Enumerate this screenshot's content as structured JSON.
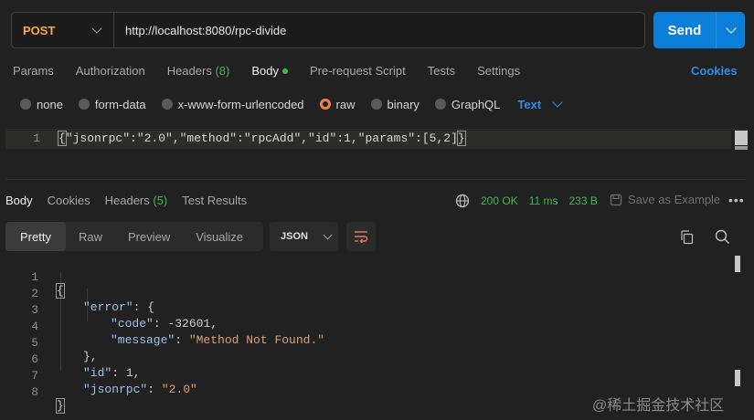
{
  "request": {
    "method": "POST",
    "url": "http://localhost:8080/rpc-divide",
    "send_label": "Send"
  },
  "request_tabs": [
    {
      "label": "Params"
    },
    {
      "label": "Authorization"
    },
    {
      "label": "Headers",
      "count": "(8)"
    },
    {
      "label": "Body"
    },
    {
      "label": "Pre-request Script"
    },
    {
      "label": "Tests"
    },
    {
      "label": "Settings"
    }
  ],
  "cookies_label": "Cookies",
  "body_types": [
    "none",
    "form-data",
    "x-www-form-urlencoded",
    "raw",
    "binary",
    "GraphQL"
  ],
  "body_format": "Text",
  "request_body": {
    "line_number": "1",
    "open_brace": "{",
    "content": "\"jsonrpc\":\"2.0\",\"method\":\"rpcAdd\",\"id\":1,\"params\":[5,2]",
    "close_brace": "}"
  },
  "response_tabs": [
    {
      "label": "Body"
    },
    {
      "label": "Cookies"
    },
    {
      "label": "Headers",
      "count": "(5)"
    },
    {
      "label": "Test Results"
    }
  ],
  "status": {
    "code": "200 OK",
    "time": "11 ms",
    "size": "233 B"
  },
  "save_example_label": "Save as Example",
  "view_modes": [
    "Pretty",
    "Raw",
    "Preview",
    "Visualize"
  ],
  "response_format": "JSON",
  "response_lines": {
    "l1": {
      "n": "1",
      "t": "{"
    },
    "l2": {
      "n": "2",
      "key": "\"error\"",
      "rest": ": {"
    },
    "l3": {
      "n": "3",
      "key": "\"code\"",
      "sep": ": ",
      "num": "-32601",
      "rest": ","
    },
    "l4": {
      "n": "4",
      "key": "\"message\"",
      "sep": ": ",
      "str": "\"Method Not Found.\""
    },
    "l5": {
      "n": "5",
      "t": "},"
    },
    "l6": {
      "n": "6",
      "key": "\"id\"",
      "sep": ": ",
      "num": "1",
      "rest": ","
    },
    "l7": {
      "n": "7",
      "key": "\"jsonrpc\"",
      "sep": ": ",
      "str": "\"2.0\""
    },
    "l8": {
      "n": "8",
      "t": "}"
    }
  },
  "watermark": "@稀土掘金技术社区",
  "colors": {
    "accent": "#0b7fd9",
    "method": "#f7a94a",
    "success": "#3fb950",
    "link": "#2d8fe8"
  }
}
